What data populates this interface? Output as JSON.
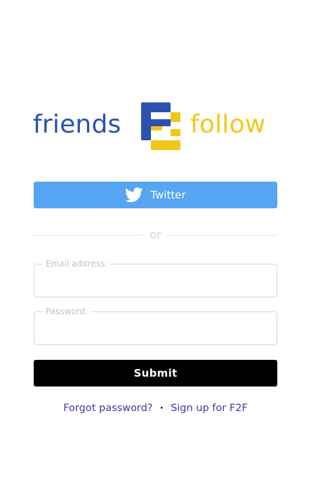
{
  "logo": {
    "left_word": "friends",
    "right_word": "follow",
    "mark_label": "F2F logo mark",
    "colors": {
      "blue": "#2a52b0",
      "yellow": "#f2c71c"
    }
  },
  "twitter_button": {
    "label": "Twitter",
    "icon": "twitter-bird-icon",
    "color": "#55a5f2"
  },
  "divider": {
    "text": "or"
  },
  "form": {
    "email": {
      "label": "Email address:",
      "value": ""
    },
    "password": {
      "label": "Password:",
      "value": ""
    },
    "submit_label": "Submit"
  },
  "links": {
    "forgot": "Forgot password?",
    "separator": "·",
    "signup": "Sign up for F2F",
    "color": "#3d3ba3"
  }
}
